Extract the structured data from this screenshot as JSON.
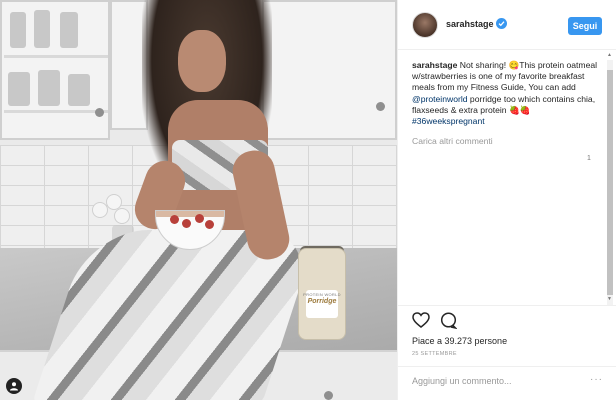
{
  "post": {
    "username": "sarahstage",
    "follow_label": "Segui",
    "caption_rest": " Not sharing! 😋This protein oatmeal w/strawberries is one of my favorite breakfast meals from my Fitness Guide, You can add ",
    "caption_mention": "@proteinworld",
    "caption_after": " porridge too which contains chia, flaxseeds & extra protein 🍓🍓 ",
    "caption_hashtag": "#36weekspregnant",
    "load_more": "Carica altri commenti",
    "likes_text": "Piace a 39.273 persone",
    "date": "25 SETTEMBRE",
    "comment_placeholder": "Aggiungi un commento...",
    "more_options": "···"
  },
  "photo": {
    "jar_brand": "PROTEIN WORLD",
    "jar_label": "Porridge"
  },
  "scroll_marker": "1",
  "colors": {
    "accent": "#3897f0",
    "text": "#262626",
    "muted": "#999999"
  }
}
